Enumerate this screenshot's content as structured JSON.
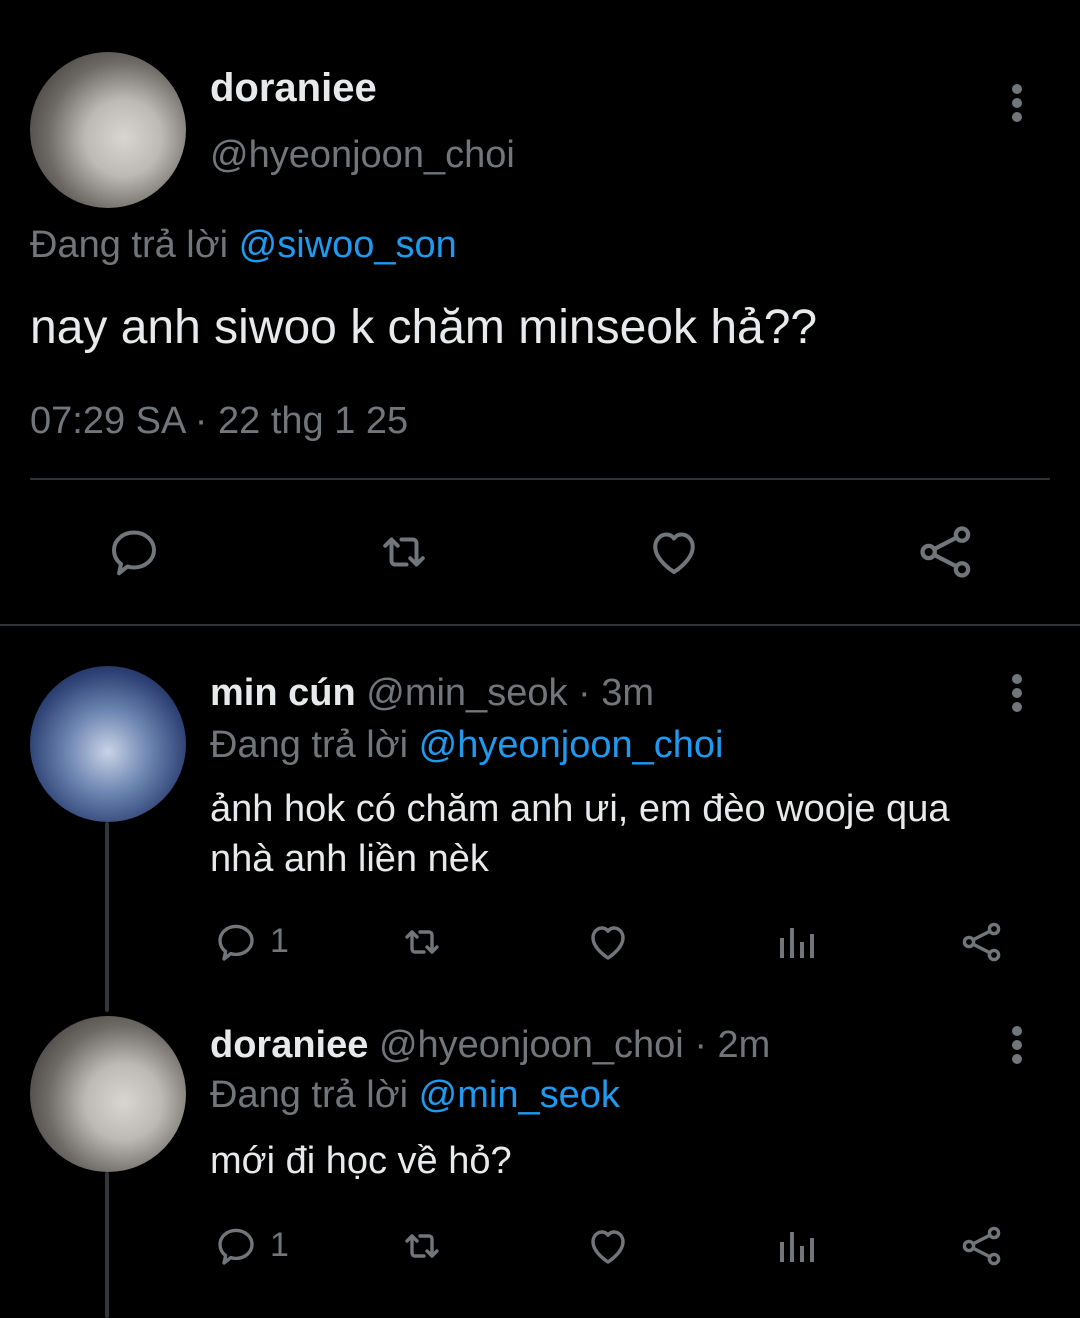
{
  "main_tweet": {
    "display_name": "doraniee",
    "handle": "@hyeonjoon_choi",
    "replying_prefix": "Đang trả lời",
    "replying_to": "@siwoo_son",
    "text": "nay anh siwoo k chăm minseok hả??",
    "timestamp": "07:29 SA · 22 thg 1 25",
    "actions": {
      "reply_icon": "reply-icon",
      "retweet_icon": "retweet-icon",
      "like_icon": "heart-icon",
      "share_icon": "share-icon"
    }
  },
  "replies": [
    {
      "display_name": "min cún",
      "handle": "@min_seok",
      "time": " · 3m",
      "replying_prefix": "Đang trả lời",
      "replying_to": "@hyeonjoon_choi",
      "text_line1": "ảnh hok có chăm anh ưi, em đèo wooje qua",
      "text_line2": "nhà anh liền nèk",
      "reply_count": "1"
    },
    {
      "display_name": "doraniee",
      "handle": "@hyeonjoon_choi",
      "time": " · 2m",
      "replying_prefix": "Đang trả lời",
      "replying_to": "@min_seok",
      "text_line1": "mới đi học về hỏ?",
      "reply_count": "1"
    }
  ],
  "colors": {
    "background": "#000000",
    "text": "#e7e9ea",
    "muted": "#71767b",
    "link": "#1d9bf0",
    "divider": "#2f3336"
  }
}
